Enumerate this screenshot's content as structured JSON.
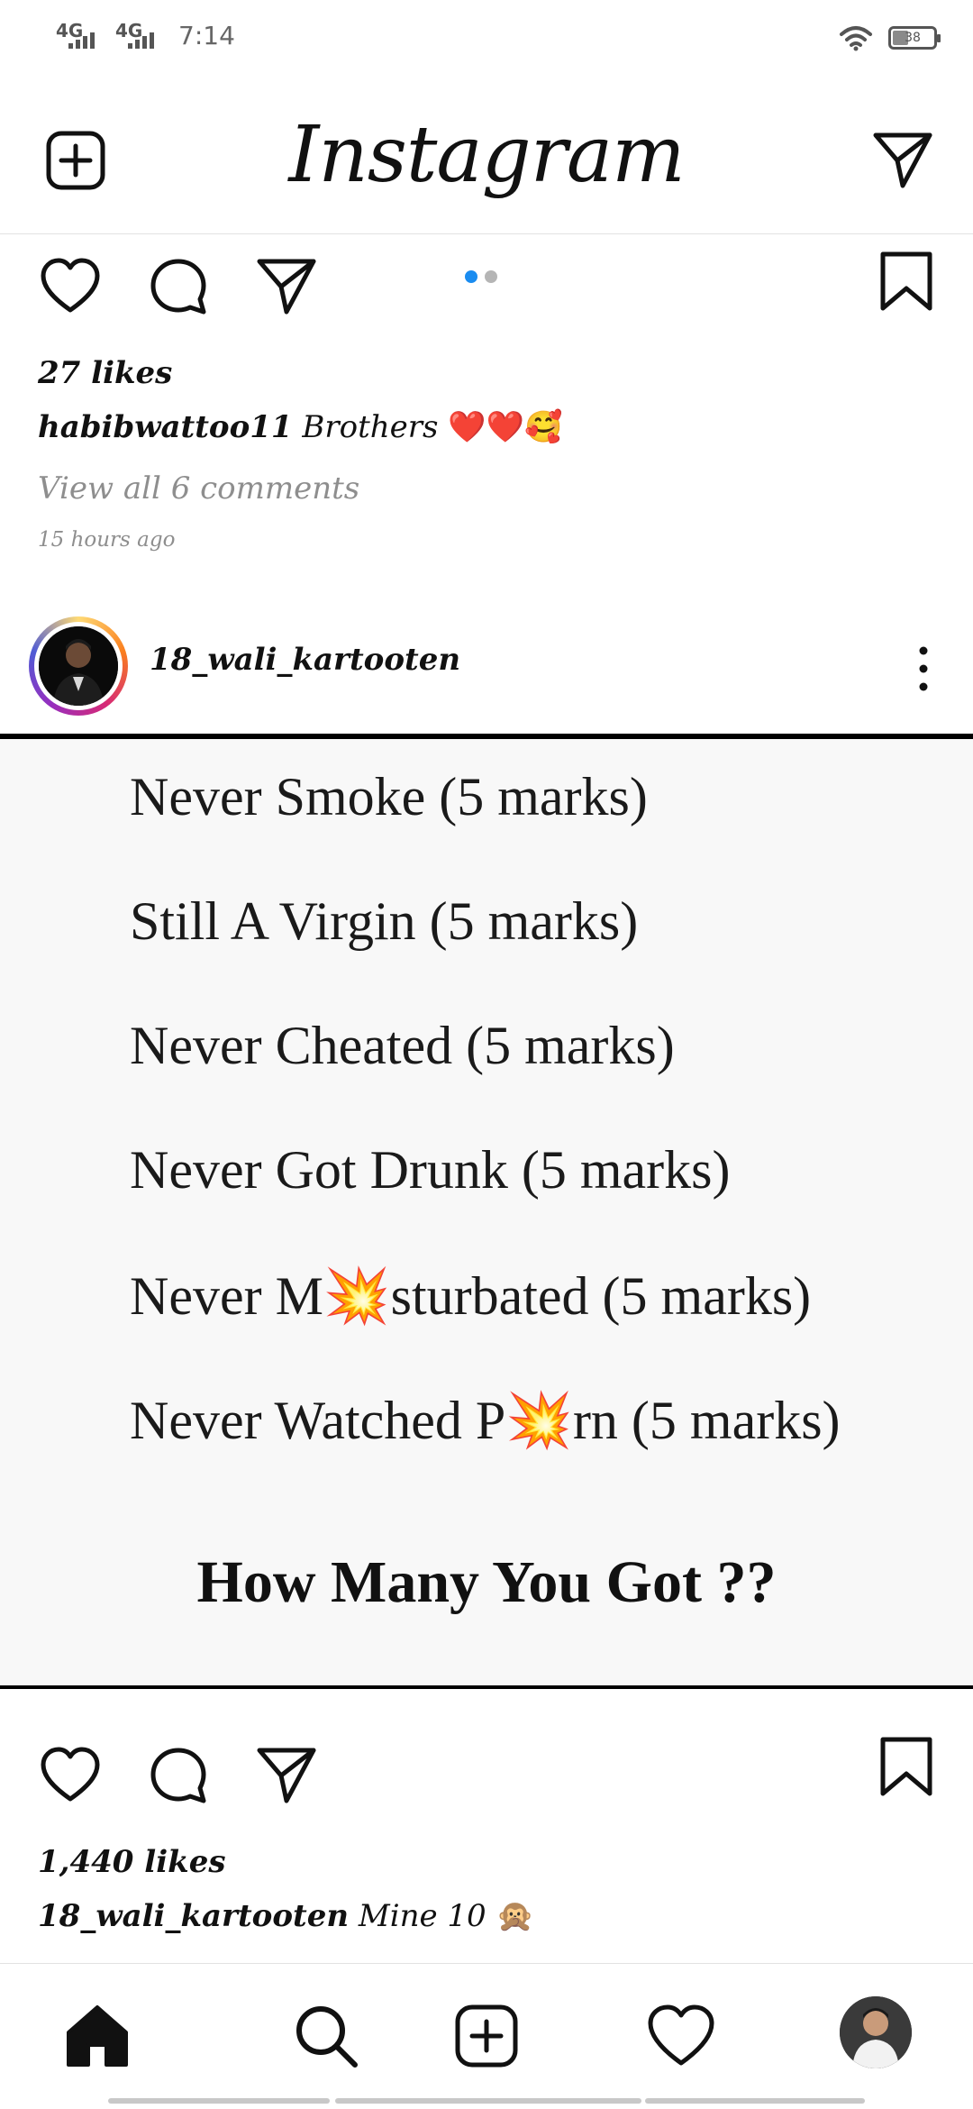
{
  "status_bar": {
    "network_1": "4G",
    "network_2": "4G",
    "time": "7:14",
    "battery_level": "38"
  },
  "header": {
    "title": "Instagram",
    "new_post_icon": "plus-square-icon",
    "direct_icon": "paper-plane-icon"
  },
  "previous_post": {
    "likes": "27 likes",
    "caption_user": "habibwattoo11",
    "caption_text": "Brothers",
    "caption_emoji": "❤️❤️🥰",
    "view_comments": "View all 6 comments",
    "time_ago": "15 hours ago",
    "carousel_dots": 2,
    "carousel_active_index": 0
  },
  "post": {
    "username": "18_wali_kartooten",
    "image_lines": [
      "Never Smoke (5 marks)",
      "Still A Virgin (5 marks)",
      "Never Cheated (5 marks)",
      "Never Got Drunk (5 marks)",
      "Never M💥sturbated (5 marks)",
      "Never Watched P💥rn (5 marks)"
    ],
    "image_question": "How Many You Got ??",
    "likes": "1,440 likes",
    "caption_user": "18_wali_kartooten",
    "caption_text": "Mine 10",
    "caption_emoji": "🙊"
  },
  "bottom_nav": {
    "items": [
      "home-icon",
      "search-icon",
      "add-post-icon",
      "activity-heart-icon",
      "profile-avatar"
    ]
  },
  "colors": {
    "accent_blue": "#1a8cf0",
    "muted_gray": "#8e8e8e"
  }
}
